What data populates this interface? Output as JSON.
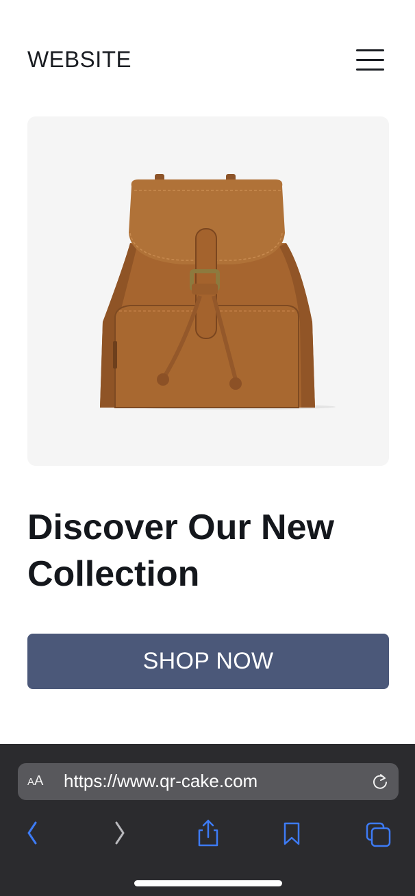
{
  "header": {
    "site_title": "WEBSITE",
    "menu_icon": "hamburger-menu-icon"
  },
  "hero": {
    "image_subject": "tan leather backpack",
    "background_color": "#f5f5f5",
    "product_color": "#a8683a"
  },
  "main": {
    "headline": "Discover Our New Collection",
    "cta_label": "SHOP NOW",
    "cta_color": "#4b5879"
  },
  "browser": {
    "reader_label_small": "A",
    "reader_label_large": "A",
    "url": "https://www.qr-cake.com",
    "reload_icon": "reload-icon",
    "toolbar": [
      "back-icon",
      "forward-icon",
      "share-icon",
      "bookmarks-icon",
      "tabs-icon"
    ],
    "accent_color": "#3d7bf5"
  }
}
